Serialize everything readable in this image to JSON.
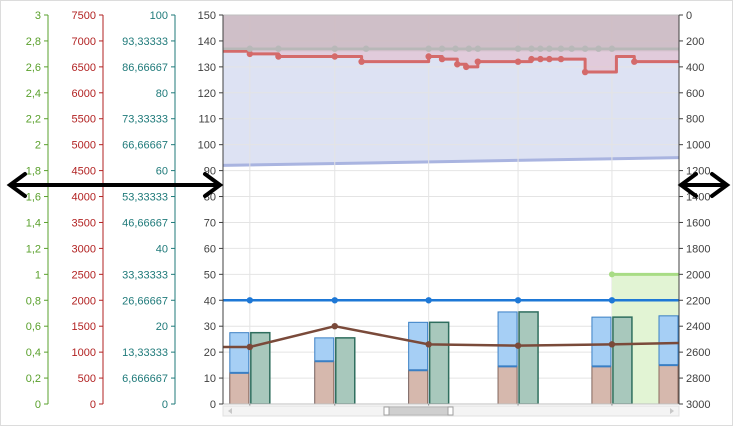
{
  "colors": {
    "axis_green": "#5aa02c",
    "axis_red": "#b22222",
    "axis_teal": "#1f7a7a",
    "axis_dark": "#404040",
    "band_lavender": "#dde2f3",
    "band_mauve": "#cdb8c0",
    "line_red": "#d46a6a",
    "line_gray": "#b8b8b8",
    "line_blue": "#1e78d6",
    "line_brown": "#7a4a3a",
    "bar_blue": "#a6cff5",
    "bar_blue_edge": "#3a7fc4",
    "bar_tan": "#d6b8ad",
    "bar_teal": "#a8c8bc",
    "bar_teal_edge": "#2f6e5e",
    "green_zone": "#e2f4d4",
    "green_line": "#a8dc85",
    "arrow": "#000000"
  },
  "icons": {
    "left_cursor": "double-arrow-horizontal-icon",
    "right_cursor": "double-arrow-horizontal-icon"
  },
  "chart_data": {
    "type": "combo",
    "axes": {
      "y_green": {
        "ticks": [
          "0",
          "0,2",
          "0,4",
          "0,6",
          "0,8",
          "1",
          "1,2",
          "1,4",
          "1,6",
          "1,8",
          "2",
          "2,2",
          "2,4",
          "2,6",
          "2,8",
          "3"
        ],
        "ylim": [
          0,
          3
        ]
      },
      "y_red": {
        "ticks": [
          "0",
          "500",
          "1000",
          "1500",
          "2000",
          "2500",
          "3000",
          "3500",
          "4000",
          "4500",
          "5000",
          "5500",
          "6000",
          "6500",
          "7000",
          "7500"
        ],
        "ylim": [
          0,
          7500
        ]
      },
      "y_teal": {
        "ticks": [
          "0",
          "6,666667",
          "13,33333",
          "20",
          "26,66667",
          "33,33333",
          "40",
          "46,66667",
          "53,33333",
          "60",
          "66,66667",
          "73,33333",
          "80",
          "86,66667",
          "93,33333",
          "100"
        ],
        "ylim": [
          0,
          100
        ]
      },
      "y_primary": {
        "ticks": [
          "0",
          "10",
          "20",
          "30",
          "40",
          "50",
          "60",
          "70",
          "80",
          "90",
          "100",
          "110",
          "120",
          "130",
          "140",
          "150"
        ],
        "ylim": [
          0,
          150
        ]
      },
      "y_right": {
        "ticks": [
          "0",
          "200",
          "400",
          "600",
          "800",
          "1000",
          "1200",
          "1400",
          "1600",
          "1800",
          "2000",
          "2200",
          "2400",
          "2600",
          "2800",
          "3000"
        ],
        "ylim": [
          0,
          3000
        ],
        "reversed": true
      },
      "x": {
        "xlim": [
          0,
          5.1
        ],
        "ticks": [
          0.3,
          1.25,
          2.3,
          3.3,
          4.35
        ],
        "grid": true
      }
    },
    "band_lavender": {
      "x": [
        0,
        5.1
      ],
      "bottom": [
        92,
        95
      ],
      "top": 150
    },
    "band_mauve": {
      "x": [
        0,
        5.1
      ],
      "bottom": 136,
      "top": 150
    },
    "series": [
      {
        "kind": "step",
        "color_key": "line_red",
        "points": [
          [
            0.0,
            136
          ],
          [
            0.3,
            135
          ],
          [
            0.62,
            134
          ],
          [
            1.25,
            134
          ],
          [
            1.55,
            132
          ],
          [
            2.3,
            134
          ],
          [
            2.45,
            133
          ],
          [
            2.62,
            131
          ],
          [
            2.72,
            130
          ],
          [
            2.85,
            132
          ],
          [
            3.3,
            132
          ],
          [
            3.45,
            133
          ],
          [
            3.78,
            133
          ],
          [
            4.05,
            128
          ],
          [
            4.35,
            128
          ],
          [
            4.4,
            134
          ],
          [
            4.6,
            132
          ],
          [
            5.1,
            132
          ]
        ],
        "markers_x": [
          0.3,
          0.62,
          1.25,
          1.55,
          2.3,
          2.45,
          2.62,
          2.72,
          2.85,
          3.3,
          3.45,
          3.55,
          3.65,
          3.78,
          4.05,
          4.6
        ]
      },
      {
        "kind": "line",
        "color_key": "line_gray",
        "points": [
          [
            0.0,
            137
          ],
          [
            5.1,
            137
          ]
        ],
        "markers_x": [
          0.3,
          0.62,
          1.25,
          1.6,
          2.3,
          2.45,
          2.6,
          2.75,
          2.85,
          3.3,
          3.45,
          3.55,
          3.65,
          3.78,
          3.9,
          4.05,
          4.2,
          4.35
        ]
      },
      {
        "kind": "line",
        "color_key": "line_blue",
        "points": [
          [
            0.0,
            40
          ],
          [
            0.3,
            40
          ],
          [
            1.25,
            40
          ],
          [
            2.3,
            40
          ],
          [
            3.3,
            40
          ],
          [
            4.35,
            40
          ],
          [
            5.1,
            40
          ]
        ],
        "markers_x": [
          0.3,
          1.25,
          2.3,
          3.3,
          4.35
        ]
      },
      {
        "kind": "line",
        "color_key": "line_brown",
        "points": [
          [
            0.0,
            22
          ],
          [
            0.3,
            22
          ],
          [
            1.25,
            30
          ],
          [
            2.3,
            23
          ],
          [
            3.3,
            22.5
          ],
          [
            4.35,
            23
          ],
          [
            5.1,
            23.5
          ]
        ],
        "markers_x": [
          0.3,
          1.25,
          2.3,
          3.3,
          4.35
        ]
      },
      {
        "kind": "green_zone",
        "color_key": "green_line",
        "x": [
          4.35,
          5.1
        ],
        "top": 50
      }
    ],
    "bar_groups": [
      {
        "x": 0.3,
        "total": 27.5,
        "base": 12,
        "side": 27.5
      },
      {
        "x": 1.25,
        "total": 25.5,
        "base": 16.5,
        "side": 25.5
      },
      {
        "x": 2.3,
        "total": 31.5,
        "base": 13,
        "side": 31.5
      },
      {
        "x": 3.3,
        "total": 35.5,
        "base": 14.5,
        "side": 35.5
      },
      {
        "x": 4.35,
        "total": 33.5,
        "base": 14.5,
        "side": 33.5
      },
      {
        "x": 5.1,
        "total": 34,
        "base": 15,
        "side": 34
      }
    ]
  }
}
